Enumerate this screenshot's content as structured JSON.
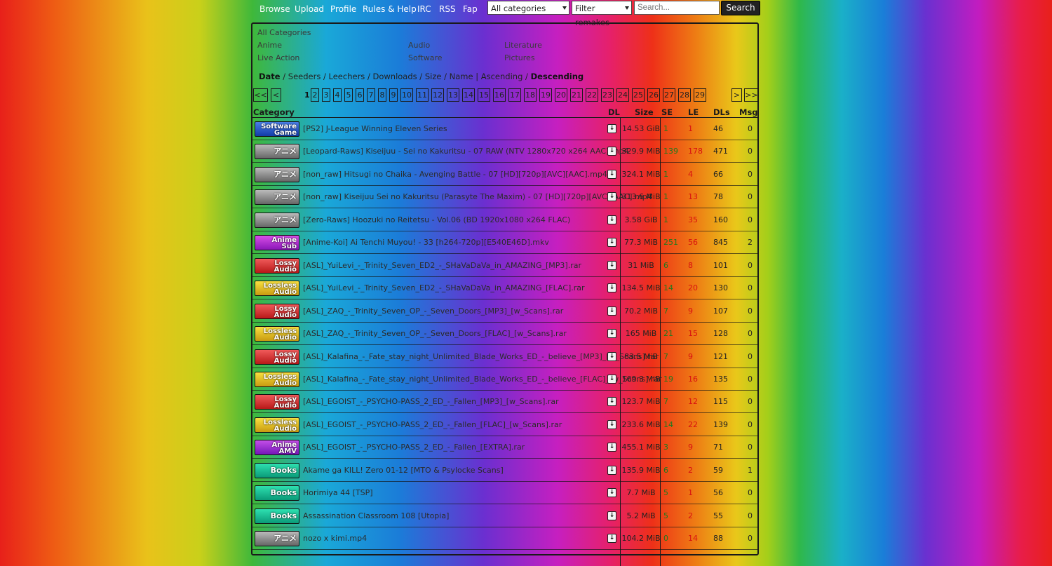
{
  "nav": {
    "links": [
      "Browse",
      "Upload",
      "Profile",
      "Rules & Help",
      "IRC",
      "RSS",
      "Fap"
    ],
    "category_select": "All categories",
    "filter_select": "Filter remakes",
    "search_placeholder": "Search...",
    "search_button": "Search"
  },
  "categories": {
    "all": "All Categories",
    "col1": [
      "Anime",
      "Live Action"
    ],
    "col2": [
      "Audio",
      "Software"
    ],
    "col3": [
      "Literature",
      "Pictures"
    ]
  },
  "sort": {
    "date": "Date",
    "seeders": "Seeders",
    "leechers": "Leechers",
    "downloads": "Downloads",
    "size": "Size",
    "name": "Name",
    "ascending": "Ascending",
    "descending": "Descending"
  },
  "pagination": {
    "first": "<<",
    "prev": "<",
    "current": "1",
    "pages": [
      "2",
      "3",
      "4",
      "5",
      "6",
      "7",
      "8",
      "9",
      "10",
      "11",
      "12",
      "13",
      "14",
      "15",
      "16",
      "17",
      "18",
      "19",
      "20",
      "21",
      "22",
      "23",
      "24",
      "25",
      "26",
      "27",
      "28",
      "29"
    ],
    "next": ">",
    "last": ">>"
  },
  "table": {
    "headers": {
      "category": "Category",
      "dl": "DL",
      "size": "Size",
      "se": "SE",
      "le": "LE",
      "dls": "DLs",
      "msg": "Msg"
    },
    "rows": [
      {
        "badge": [
          "Software",
          "Game"
        ],
        "badge_class": "b-software",
        "name": "[PS2] J-League Winning Eleven Series",
        "size": "14.53 GiB",
        "se": "1",
        "le": "1",
        "dls": "46",
        "msg": "0"
      },
      {
        "badge": [
          "アニメ"
        ],
        "badge_class": "b-raw",
        "name": "[Leopard-Raws] Kiseijuu - Sei no Kakuritsu - 07 RAW (NTV 1280x720 x264 AAC).mp4",
        "size": "329.9 MiB",
        "se": "139",
        "le": "178",
        "dls": "471",
        "msg": "0"
      },
      {
        "badge": [
          "アニメ"
        ],
        "badge_class": "b-raw",
        "name": "[non_raw] Hitsugi no Chaika - Avenging Battle - 07 [HD][720p][AVC][AAC].mp4",
        "size": "324.1 MiB",
        "se": "1",
        "le": "4",
        "dls": "66",
        "msg": "0"
      },
      {
        "badge": [
          "アニメ"
        ],
        "badge_class": "b-raw",
        "name": "[non_raw] Kiseijuu Sei no Kakuritsu (Parasyte The Maxim) - 07 [HD][720p][AVC][AAC].mp4",
        "size": "313.6 MiB",
        "se": "1",
        "le": "13",
        "dls": "78",
        "msg": "0"
      },
      {
        "badge": [
          "アニメ"
        ],
        "badge_class": "b-raw",
        "name": "[Zero-Raws] Hoozuki no Reitetsu - Vol.06 (BD 1920x1080 x264 FLAC)",
        "size": "3.58 GiB",
        "se": "1",
        "le": "35",
        "dls": "160",
        "msg": "0"
      },
      {
        "badge": [
          "Anime",
          "Sub"
        ],
        "badge_class": "b-sub",
        "name": "[Anime-Koi] Ai Tenchi Muyou! - 33 [h264-720p][E540E46D].mkv",
        "size": "77.3 MiB",
        "se": "251",
        "le": "56",
        "dls": "845",
        "msg": "2"
      },
      {
        "badge": [
          "Lossy",
          "Audio"
        ],
        "badge_class": "b-lossy",
        "name": "[ASL]_YuiLevi_-_Trinity_Seven_ED2_-_SHaVaDaVa_in_AMAZING_[MP3].rar",
        "size": "31 MiB",
        "se": "6",
        "le": "8",
        "dls": "101",
        "msg": "0"
      },
      {
        "badge": [
          "Lossless",
          "Audio"
        ],
        "badge_class": "b-lossless",
        "name": "[ASL]_YuiLevi_-_Trinity_Seven_ED2_-_SHaVaDaVa_in_AMAZING_[FLAC].rar",
        "size": "134.5 MiB",
        "se": "14",
        "le": "20",
        "dls": "130",
        "msg": "0"
      },
      {
        "badge": [
          "Lossy",
          "Audio"
        ],
        "badge_class": "b-lossy",
        "name": "[ASL]_ZAQ_-_Trinity_Seven_OP_-_Seven_Doors_[MP3]_[w_Scans].rar",
        "size": "70.2 MiB",
        "se": "7",
        "le": "9",
        "dls": "107",
        "msg": "0"
      },
      {
        "badge": [
          "Lossless",
          "Audio"
        ],
        "badge_class": "b-lossless",
        "name": "[ASL]_ZAQ_-_Trinity_Seven_OP_-_Seven_Doors_[FLAC]_[w_Scans].rar",
        "size": "165 MiB",
        "se": "21",
        "le": "15",
        "dls": "128",
        "msg": "0"
      },
      {
        "badge": [
          "Lossy",
          "Audio"
        ],
        "badge_class": "b-lossy",
        "name": "[ASL]_Kalafina_-_Fate_stay_night_Unlimited_Blade_Works_ED_-_believe_[MP3]_[w_Scans].rar",
        "size": "83.5 MiB",
        "se": "7",
        "le": "9",
        "dls": "121",
        "msg": "0"
      },
      {
        "badge": [
          "Lossless",
          "Audio"
        ],
        "badge_class": "b-lossless",
        "name": "[ASL]_Kalafina_-_Fate_stay_night_Unlimited_Blade_Works_ED_-_believe_[FLAC]_[w_Scans].rar",
        "size": "169.3 MiB",
        "se": "19",
        "le": "16",
        "dls": "135",
        "msg": "0"
      },
      {
        "badge": [
          "Lossy",
          "Audio"
        ],
        "badge_class": "b-lossy",
        "name": "[ASL]_EGOIST_-_PSYCHO-PASS_2_ED_-_Fallen_[MP3]_[w_Scans].rar",
        "size": "123.7 MiB",
        "se": "7",
        "le": "12",
        "dls": "115",
        "msg": "0"
      },
      {
        "badge": [
          "Lossless",
          "Audio"
        ],
        "badge_class": "b-lossless",
        "name": "[ASL]_EGOIST_-_PSYCHO-PASS_2_ED_-_Fallen_[FLAC]_[w_Scans].rar",
        "size": "233.6 MiB",
        "se": "14",
        "le": "22",
        "dls": "139",
        "msg": "0"
      },
      {
        "badge": [
          "Anime",
          "AMV"
        ],
        "badge_class": "b-amv",
        "name": "[ASL]_EGOIST_-_PSYCHO-PASS_2_ED_-_Fallen_[EXTRA].rar",
        "size": "455.1 MiB",
        "se": "3",
        "le": "9",
        "dls": "71",
        "msg": "0"
      },
      {
        "badge": [
          "Books"
        ],
        "badge_class": "b-books",
        "name": "Akame ga KILL! Zero 01-12 [MTO & Psylocke Scans]",
        "size": "135.9 MiB",
        "se": "6",
        "le": "2",
        "dls": "59",
        "msg": "1"
      },
      {
        "badge": [
          "Books"
        ],
        "badge_class": "b-books",
        "name": "Horimiya 44 [TSP]",
        "size": "7.7 MiB",
        "se": "5",
        "le": "1",
        "dls": "56",
        "msg": "0"
      },
      {
        "badge": [
          "Books"
        ],
        "badge_class": "b-books",
        "name": "Assassination Classroom 108 [Utopia]",
        "size": "5.2 MiB",
        "se": "5",
        "le": "2",
        "dls": "55",
        "msg": "0"
      },
      {
        "badge": [
          "アニメ"
        ],
        "badge_class": "b-raw",
        "name": "nozo x kimi.mp4",
        "size": "104.2 MiB",
        "se": "0",
        "le": "14",
        "dls": "88",
        "msg": "0"
      }
    ]
  }
}
